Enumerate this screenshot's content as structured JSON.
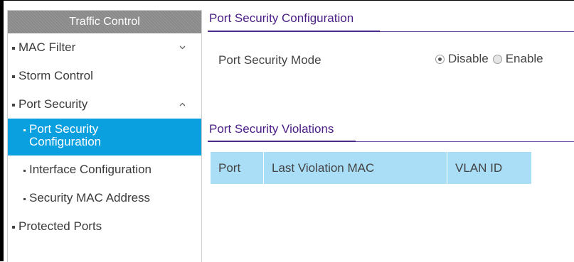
{
  "sidebar": {
    "header": "Traffic Control",
    "items": [
      {
        "label": "MAC Filter",
        "chevron": "chevron-down-icon"
      },
      {
        "label": "Storm Control"
      },
      {
        "label": "Port Security",
        "chevron": "chevron-up-icon"
      },
      {
        "label": "Port Security Configuration",
        "active": true
      },
      {
        "label": "Interface Configuration"
      },
      {
        "label": "Security MAC Address"
      },
      {
        "label": "Protected Ports"
      }
    ]
  },
  "config_section": {
    "title": "Port Security Configuration",
    "mode_label": "Port Security Mode",
    "options": [
      {
        "label": "Disable",
        "selected": true
      },
      {
        "label": "Enable",
        "selected": false
      }
    ]
  },
  "violations_section": {
    "title": "Port Security Violations",
    "columns": [
      "Port",
      "Last Violation MAC",
      "VLAN ID"
    ]
  },
  "colors": {
    "accent": "#0aa0e0",
    "title": "#4a1d87",
    "table_header": "#a9def6"
  }
}
